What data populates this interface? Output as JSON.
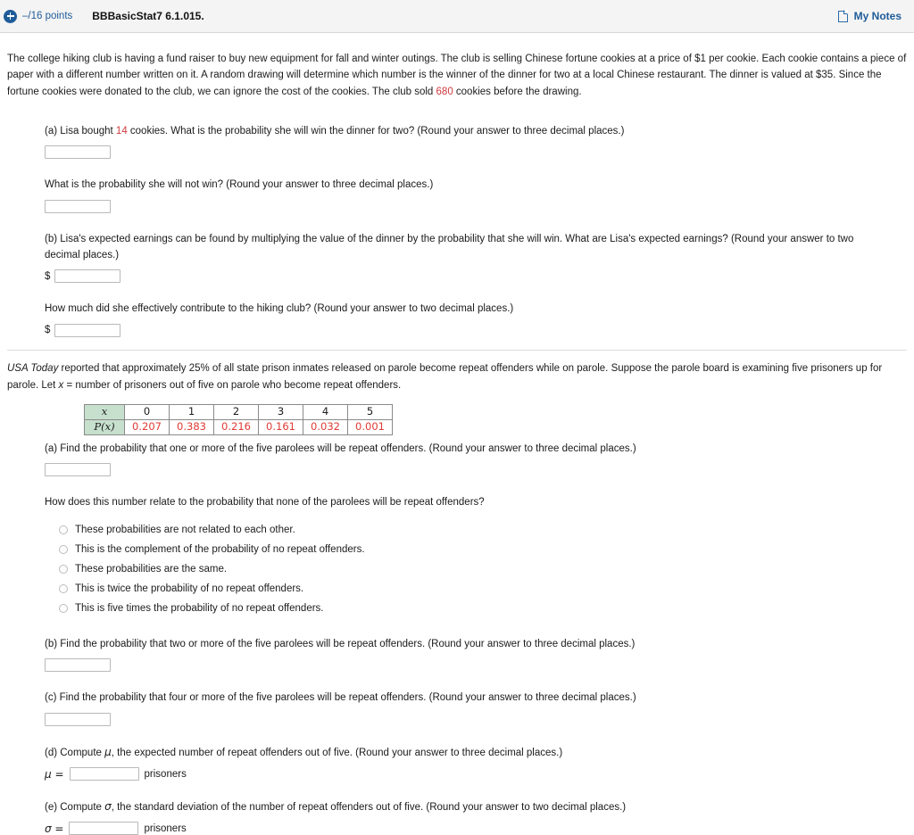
{
  "header": {
    "plus_icon": "plus-circle-icon",
    "points": "–/16 points",
    "textbook_ref": "BBBasicStat7 6.1.015.",
    "notes_icon": "note-page-icon",
    "notes_label": "My Notes"
  },
  "colors": {
    "accent_blue": "#1f5c99",
    "highlight_red": "#d0393e",
    "table_header_green": "#c6e0cd",
    "table_value_red": "#e03a35"
  },
  "problem1": {
    "intro_part1": "The college hiking club is having a fund raiser to buy new equipment for fall and winter outings. The club is selling Chinese fortune cookies at a price of $1 per cookie. Each cookie contains a piece of paper with a different number written on it. A random drawing will determine which number is the winner of the dinner for two at a local Chinese restaurant. The dinner is valued at $35. Since the fortune cookies were donated to the club, we can ignore the cost of the cookies. The club sold ",
    "cookies_sold": "680",
    "intro_part2": " cookies before the drawing.",
    "part_a_pre": "(a) Lisa bought ",
    "part_a_count": "14",
    "part_a_post": " cookies. What is the probability she will win the dinner for two? (Round your answer to three decimal places.)",
    "part_a_not_win": "What is the probability she will not win? (Round your answer to three decimal places.)",
    "part_b": "(b) Lisa's expected earnings can be found by multiplying the value of the dinner by the probability that she will win. What are Lisa's expected earnings? (Round your answer to two decimal places.)",
    "part_b_money_symbol": "$",
    "part_b_contribute": "How much did she effectively contribute to the hiking club? (Round your answer to two decimal places.)",
    "part_b_contribute_money_symbol": "$"
  },
  "problem2": {
    "source_italic": "USA Today",
    "intro_rest": " reported that approximately 25% of all state prison inmates released on parole become repeat offenders while on parole. Suppose the parole board is examining five prisoners up for parole. Let ",
    "intro_var": "x",
    "intro_tail": " = number of prisoners out of five on parole who become repeat offenders.",
    "table": {
      "row_header_x": "x",
      "row_header_px": "P(x)",
      "x_values": [
        "0",
        "1",
        "2",
        "3",
        "4",
        "5"
      ],
      "p_values": [
        "0.207",
        "0.383",
        "0.216",
        "0.161",
        "0.032",
        "0.001"
      ]
    },
    "part_a": "(a) Find the probability that one or more of the five parolees will be repeat offenders. (Round your answer to three decimal places.)",
    "relate_question": "How does this number relate to the probability that none of the parolees will be repeat offenders?",
    "options": [
      "These probabilities are not related to each other.",
      "This is the complement of the probability of no repeat offenders.",
      "These probabilities are the same.",
      "This is twice the probability of no repeat offenders.",
      "This is five times the probability of no repeat offenders."
    ],
    "part_b": "(b) Find the probability that two or more of the five parolees will be repeat offenders. (Round your answer to three decimal places.)",
    "part_c": "(c) Find the probability that four or more of the five parolees will be repeat offenders. (Round your answer to three decimal places.)",
    "part_d_pre": "(d) Compute ",
    "part_d_symbol": "μ",
    "part_d_post": ", the expected number of repeat offenders out of five. (Round your answer to three decimal places.)",
    "part_d_eq": "μ =",
    "part_d_unit": "prisoners",
    "part_e_pre": "(e) Compute ",
    "part_e_symbol": "σ",
    "part_e_post": ", the standard deviation of the number of repeat offenders out of five. (Round your answer to two decimal places.)",
    "part_e_eq": "σ =",
    "part_e_unit": "prisoners"
  }
}
